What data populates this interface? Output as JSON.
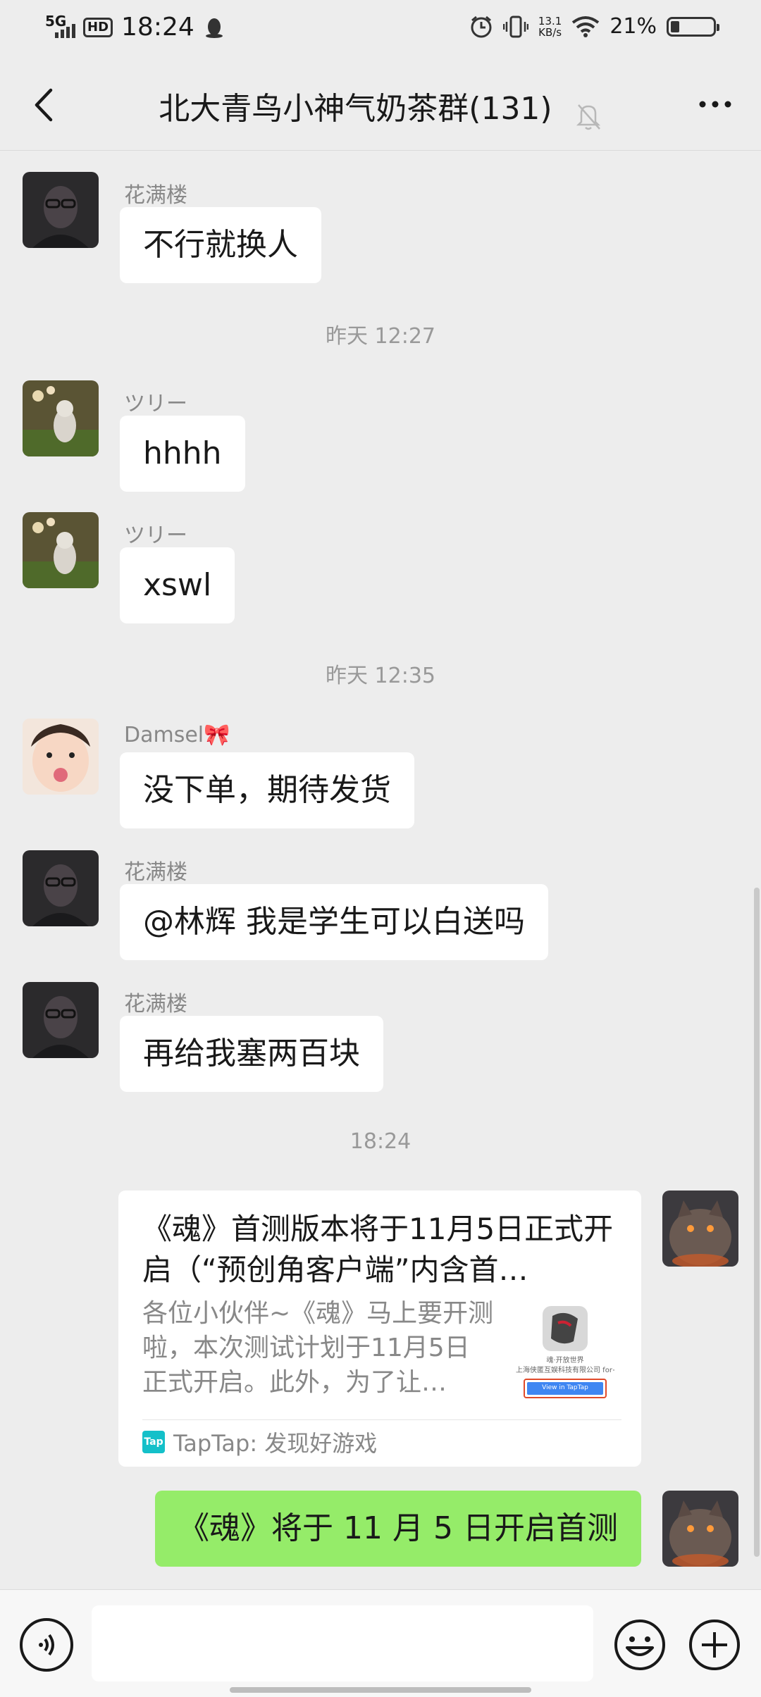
{
  "status_bar": {
    "network": "5G",
    "hd": "HD",
    "time": "18:24",
    "speed_value": "13.1",
    "speed_unit": "KB/s",
    "battery_percent": "21%",
    "battery_level": 0.21
  },
  "header": {
    "title": "北大青鸟小神气奶茶群(131)"
  },
  "messages": [
    {
      "sender": "花满楼",
      "text": "不行就换人"
    },
    {
      "timestamp": "昨天 12:27"
    },
    {
      "sender": "ツリー",
      "text": "hhhh"
    },
    {
      "sender": "ツリー",
      "text": "xswl"
    },
    {
      "timestamp": "昨天 12:35"
    },
    {
      "sender": "Damsel🎀",
      "text": "没下单，期待发货"
    },
    {
      "sender": "花满楼",
      "text": "@林辉  我是学生可以白送吗"
    },
    {
      "sender": "花满楼",
      "text": "再给我塞两百块"
    },
    {
      "timestamp": "18:24"
    },
    {
      "card": {
        "title": "《魂》首测版本将于11月5日正式开启（“预创角客户端”内含首…",
        "description": "各位小伙伴~《魂》马上要开测啦，本次测试计划于11月5日正式开启。此外，为了让…",
        "thumb_caption": "魂·开放世界",
        "thumb_company": "上海侠匿互娱科技有限公司 for+",
        "thumb_button": "View in TapTap",
        "source_logo": "Tap",
        "source": "TapTap: 发现好游戏"
      }
    },
    {
      "sender": "",
      "text": "《魂》将于 11 月 5 日开启首测",
      "me": true
    }
  ],
  "colors": {
    "background": "#ededed",
    "my_bubble": "#95ec69",
    "their_bubble": "#ffffff",
    "taptap": "#14c0c9"
  },
  "icons": {
    "back": "chevron-left-icon",
    "mute": "bell-off-icon",
    "more": "more-icon",
    "voice": "voice-icon",
    "emoji": "emoji-icon",
    "plus": "plus-icon"
  }
}
